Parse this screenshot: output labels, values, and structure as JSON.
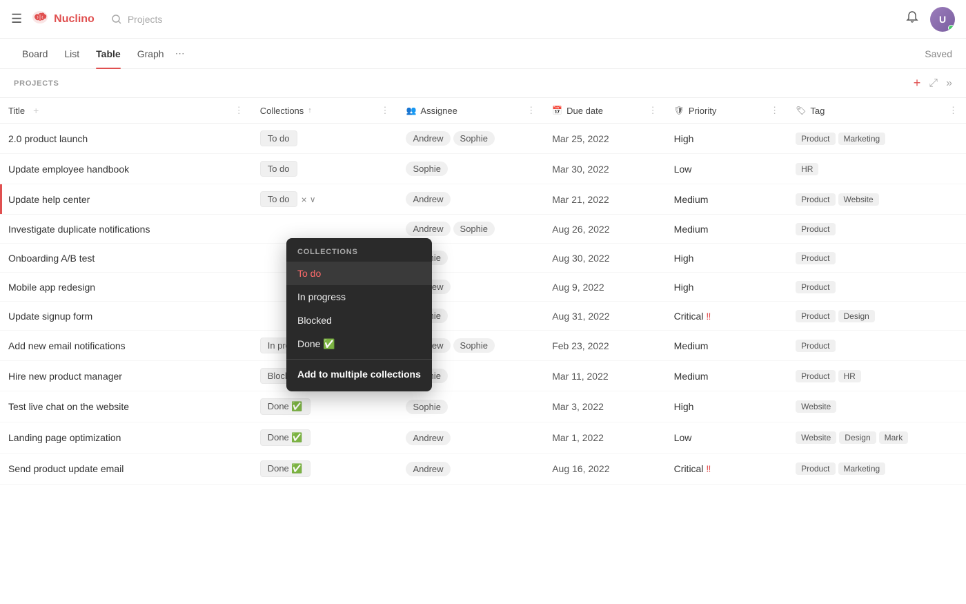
{
  "app": {
    "title": "Nuclino",
    "search_placeholder": "Projects"
  },
  "nav": {
    "tabs": [
      "Board",
      "List",
      "Table",
      "Graph"
    ],
    "active_tab": "Table",
    "more_label": "⋯",
    "saved_label": "Saved"
  },
  "projects": {
    "section_label": "PROJECTS"
  },
  "table": {
    "columns": [
      {
        "id": "title",
        "label": "Title",
        "icon": ""
      },
      {
        "id": "collections",
        "label": "Collections",
        "icon": ""
      },
      {
        "id": "assignee",
        "label": "Assignee",
        "icon": "👥"
      },
      {
        "id": "duedate",
        "label": "Due date",
        "icon": "📅"
      },
      {
        "id": "priority",
        "label": "Priority",
        "icon": "🛡"
      },
      {
        "id": "tag",
        "label": "Tag",
        "icon": "🏷"
      }
    ],
    "rows": [
      {
        "title": "2.0 product launch",
        "collection": "To do",
        "assignees": [
          "Andrew",
          "Sophie"
        ],
        "due_date": "Mar 25, 2022",
        "priority": "High",
        "priority_type": "high",
        "tags": [
          "Product",
          "Marketing"
        ],
        "highlight": false
      },
      {
        "title": "Update employee handbook",
        "collection": "To do",
        "assignees": [
          "Sophie"
        ],
        "due_date": "Mar 30, 2022",
        "priority": "Low",
        "priority_type": "low",
        "tags": [
          "HR"
        ],
        "highlight": false
      },
      {
        "title": "Update help center",
        "collection": "To do",
        "assignees": [
          "Andrew"
        ],
        "due_date": "Mar 21, 2022",
        "priority": "Medium",
        "priority_type": "medium",
        "tags": [
          "Product",
          "Website"
        ],
        "highlight": true
      },
      {
        "title": "Investigate duplicate notifications",
        "collection": "",
        "assignees": [
          "Andrew",
          "Sophie"
        ],
        "due_date": "Aug 26, 2022",
        "priority": "Medium",
        "priority_type": "medium",
        "tags": [
          "Product"
        ],
        "highlight": false
      },
      {
        "title": "Onboarding A/B test",
        "collection": "",
        "assignees": [
          "Sophie"
        ],
        "due_date": "Aug 30, 2022",
        "priority": "High",
        "priority_type": "high",
        "tags": [
          "Product"
        ],
        "highlight": false
      },
      {
        "title": "Mobile app redesign",
        "collection": "",
        "assignees": [
          "Andrew"
        ],
        "due_date": "Aug 9, 2022",
        "priority": "High",
        "priority_type": "high",
        "tags": [
          "Product"
        ],
        "highlight": false
      },
      {
        "title": "Update signup form",
        "collection": "",
        "assignees": [
          "Sophie"
        ],
        "due_date": "Aug 31, 2022",
        "priority": "Critical",
        "priority_type": "critical",
        "tags": [
          "Product",
          "Design"
        ],
        "highlight": false
      },
      {
        "title": "Add new email notifications",
        "collection": "In progress",
        "assignees": [
          "Andrew",
          "Sophie"
        ],
        "due_date": "Feb 23, 2022",
        "priority": "Medium",
        "priority_type": "medium",
        "tags": [
          "Product"
        ],
        "highlight": false
      },
      {
        "title": "Hire new product manager",
        "collection": "Blocked",
        "assignees": [
          "Sophie"
        ],
        "due_date": "Mar 11, 2022",
        "priority": "Medium",
        "priority_type": "medium",
        "tags": [
          "Product",
          "HR"
        ],
        "highlight": false
      },
      {
        "title": "Test live chat on the website",
        "collection": "Done ✅",
        "assignees": [
          "Sophie"
        ],
        "due_date": "Mar 3, 2022",
        "priority": "High",
        "priority_type": "high",
        "tags": [
          "Website"
        ],
        "highlight": false
      },
      {
        "title": "Landing page optimization",
        "collection": "Done ✅",
        "assignees": [
          "Andrew"
        ],
        "due_date": "Mar 1, 2022",
        "priority": "Low",
        "priority_type": "low",
        "tags": [
          "Website",
          "Design",
          "Mark"
        ],
        "highlight": false
      },
      {
        "title": "Send product update email",
        "collection": "Done ✅",
        "assignees": [
          "Andrew"
        ],
        "due_date": "Aug 16, 2022",
        "priority": "Critical",
        "priority_type": "critical",
        "tags": [
          "Product",
          "Marketing"
        ],
        "highlight": false
      }
    ]
  },
  "dropdown": {
    "title": "COLLECTIONS",
    "items": [
      {
        "label": "To do",
        "active": true
      },
      {
        "label": "In progress",
        "active": false
      },
      {
        "label": "Blocked",
        "active": false
      },
      {
        "label": "Done ✅",
        "active": false
      }
    ],
    "add_label": "Add to multiple collections"
  },
  "icons": {
    "hamburger": "☰",
    "search": "🔍",
    "bell": "🔔",
    "plus": "+",
    "compress": "⤢",
    "chevrons": "»",
    "sort_up": "↑",
    "col_more": "⋮",
    "row_plus": "+",
    "row_more": "⋮",
    "x": "×",
    "chevron_down": "∨"
  }
}
